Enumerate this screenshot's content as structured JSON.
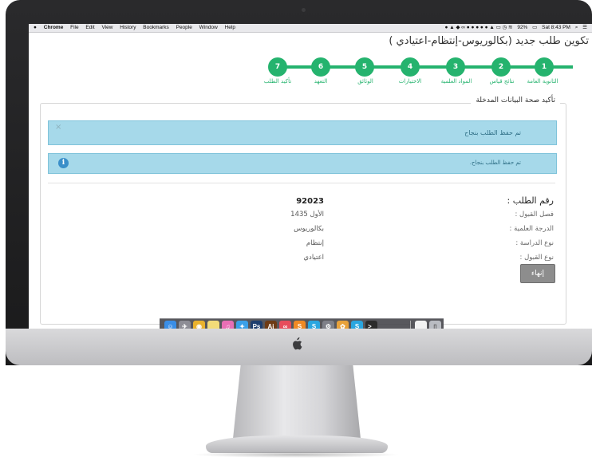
{
  "menubar": {
    "apple": "",
    "app": "Chrome",
    "items": [
      "File",
      "Edit",
      "View",
      "History",
      "Bookmarks",
      "People",
      "Window",
      "Help"
    ],
    "battery": "92%",
    "clock": "Sat 8:43 PM"
  },
  "page": {
    "title": "تكوين طلب جديد (بكالوريوس-إنتظام-اعتيادي )"
  },
  "steps": [
    {
      "number": "1",
      "label": "الثانوية العامة"
    },
    {
      "number": "2",
      "label": "نتائج قياس"
    },
    {
      "number": "3",
      "label": "المواد العلمية"
    },
    {
      "number": "4",
      "label": "الاختيارات"
    },
    {
      "number": "5",
      "label": "الوثائق"
    },
    {
      "number": "6",
      "label": "التعهد"
    },
    {
      "number": "7",
      "label": "تأكيد الطلب"
    }
  ],
  "panel": {
    "legend": "تأكيد صحة البيانات المدخلة",
    "alert_success": "تم حفظ الطلب بنجاح",
    "alert_close": "×",
    "alert_info": "تم حفظ الطلب بنجاح.",
    "alert_info_icon": "i"
  },
  "details": {
    "request_number_label": "رقم الطلب :",
    "request_number_value": "92023",
    "semester_label": "فصل القبول :",
    "semester_value": "الأول 1435",
    "degree_label": "الدرجة العلمية :",
    "degree_value": "بكالوريوس",
    "study_type_label": "نوع الدراسة :",
    "study_type_value": "إنتظام",
    "admission_type_label": "نوع القبول :",
    "admission_type_value": "اعتيادي"
  },
  "actions": {
    "finish_label": "إنهاء"
  },
  "dock": {
    "apps": [
      {
        "icon": "finder-icon",
        "glyph": "☺",
        "color": "#3a8ee6"
      },
      {
        "icon": "launchpad-icon",
        "glyph": "✈",
        "color": "#8d8d95"
      },
      {
        "icon": "chrome-icon",
        "glyph": "◉",
        "color": "#e9b22e"
      },
      {
        "icon": "notes-icon",
        "glyph": "",
        "color": "#f3dc79"
      },
      {
        "icon": "itunes-icon",
        "glyph": "♫",
        "color": "#e86fb5"
      },
      {
        "icon": "twitter-icon",
        "glyph": "✦",
        "color": "#3ba0e8"
      },
      {
        "icon": "photoshop-icon",
        "glyph": "Ps",
        "color": "#1e3e6e"
      },
      {
        "icon": "illustrator-icon",
        "glyph": "Ai",
        "color": "#6e3b14"
      },
      {
        "icon": "infinity-icon",
        "glyph": "∞",
        "color": "#e74c5c"
      },
      {
        "icon": "sublime-icon",
        "glyph": "S",
        "color": "#f08a24"
      },
      {
        "icon": "skype-icon",
        "glyph": "S",
        "color": "#2aa6e0"
      },
      {
        "icon": "settings-icon",
        "glyph": "⚙",
        "color": "#7f8088"
      },
      {
        "icon": "photos-icon",
        "glyph": "✿",
        "color": "#e8a23b"
      },
      {
        "icon": "skype2-icon",
        "glyph": "S",
        "color": "#2aa6e0"
      },
      {
        "icon": "terminal-icon",
        "glyph": ">_",
        "color": "#2b2b2b"
      },
      {
        "icon": "documents-icon",
        "glyph": "",
        "color": "#f2f2f2"
      },
      {
        "icon": "trash-icon",
        "glyph": "▯",
        "color": "#b9bcc2"
      }
    ]
  }
}
